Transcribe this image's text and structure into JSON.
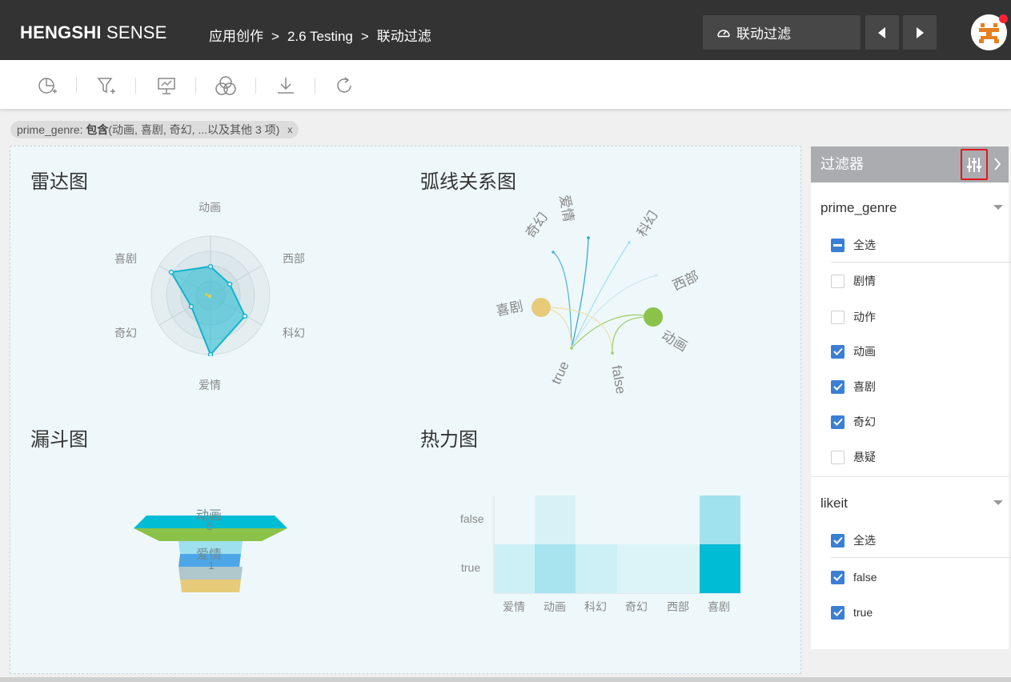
{
  "header": {
    "brand_bold": "HENGSHI",
    "brand_rest": "SENSE",
    "breadcrumb": [
      "应用创作",
      "2.6 Testing",
      "联动过滤"
    ],
    "breadcrumb_sep": ">",
    "dashboard_name": "联动过滤"
  },
  "toolbar": {
    "icons": [
      "add-chart-icon",
      "add-filter-icon",
      "presentation-icon",
      "combine-icon",
      "download-icon",
      "refresh-icon"
    ]
  },
  "active_filter": {
    "field": "prime_genre:",
    "op": "包含",
    "values": "(动画, 喜剧, 奇幻, ...以及其他 3 项)",
    "close": "x"
  },
  "charts": {
    "radar": {
      "title": "雷达图",
      "chart_data": {
        "type": "radar",
        "axes": [
          "动画",
          "西部",
          "科幻",
          "爱情",
          "奇幻",
          "喜剧"
        ]
      }
    },
    "arc": {
      "title": "弧线关系图",
      "chart_data": {
        "type": "arc",
        "nodes": [
          "奇幻",
          "爱情",
          "科幻",
          "西部",
          "喜剧",
          "动画",
          "true",
          "false"
        ]
      }
    },
    "funnel": {
      "title": "漏斗图",
      "chart_data": {
        "type": "funnel",
        "labels": [
          "动画",
          "8",
          "爱情",
          "1"
        ]
      }
    },
    "heatmap": {
      "title": "热力图",
      "chart_data": {
        "type": "heatmap",
        "x": [
          "爱情",
          "动画",
          "科幻",
          "奇幻",
          "西部",
          "喜剧"
        ],
        "y": [
          "false",
          "true"
        ]
      }
    }
  },
  "filter_panel": {
    "title": "过滤器",
    "groups": [
      {
        "name": "prime_genre",
        "select_all": "全选",
        "options": [
          {
            "label": "剧情",
            "checked": false
          },
          {
            "label": "动作",
            "checked": false
          },
          {
            "label": "动画",
            "checked": true
          },
          {
            "label": "喜剧",
            "checked": true
          },
          {
            "label": "奇幻",
            "checked": true
          },
          {
            "label": "悬疑",
            "checked": false
          }
        ]
      },
      {
        "name": "likeit",
        "select_all": "全选",
        "options": [
          {
            "label": "false",
            "checked": true
          },
          {
            "label": "true",
            "checked": true
          }
        ]
      }
    ]
  },
  "colors": {
    "topbar": "#333333",
    "accent": "#00bcd4",
    "checkbox": "#3a7fd5",
    "highlight": "#e0181c"
  }
}
